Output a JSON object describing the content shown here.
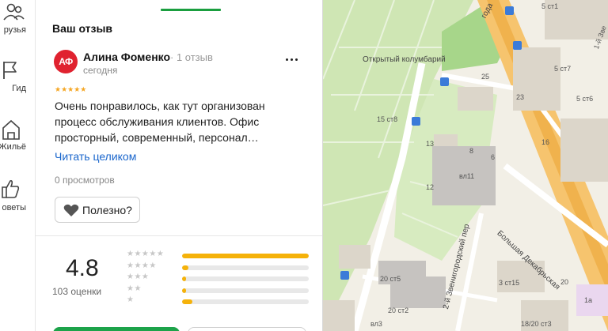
{
  "sidebar": {
    "items": [
      {
        "label": "рузья",
        "icon": "friends-icon"
      },
      {
        "label": "Гид",
        "icon": "flag-icon"
      },
      {
        "label": "Жильё",
        "icon": "house-icon"
      },
      {
        "label": "оветы",
        "icon": "thumbs-up-icon"
      }
    ]
  },
  "review": {
    "section_title": "Ваш отзыв",
    "avatar_initials": "АФ",
    "author": "Алина Фоменко",
    "author_meta": "· 1 отзыв",
    "date": "сегодня",
    "stars": "★★★★★",
    "text": "Очень понравилось, как тут организован процесс обслуживания клиентов. Офис просторный, современный, персонал…",
    "read_more": "Читать целиком",
    "views": "0 просмотров",
    "useful_label": "Полезно?"
  },
  "rating": {
    "value": "4.8",
    "count_label": "103 оценки",
    "distribution": [
      {
        "stars": "★★★★★",
        "fraction": 1.0
      },
      {
        "stars": "★★★★",
        "fraction": 0.05
      },
      {
        "stars": "★★★",
        "fraction": 0.03
      },
      {
        "stars": "★★",
        "fraction": 0.03
      },
      {
        "stars": "★",
        "fraction": 0.08
      }
    ]
  },
  "map": {
    "labels": [
      "5 ст1",
      "Открытый колумбарий",
      "25",
      "15 ст8",
      "13",
      "23",
      "вл11",
      "12",
      "Большая Декабрьская",
      "2-й Звенигородский пер",
      "20 ст5",
      "3 ст15",
      "18/20 ст3",
      "1а",
      "5 ст7",
      "5 ст6",
      "16",
      "8",
      "6",
      "20 ст2",
      "20",
      "1-й Зве",
      "года",
      "вл3"
    ]
  },
  "colors": {
    "accent_green": "#1a9e3f",
    "avatar_red": "#e0222f",
    "link_blue": "#1a66cc",
    "bar_yellow": "#f5b20a"
  }
}
